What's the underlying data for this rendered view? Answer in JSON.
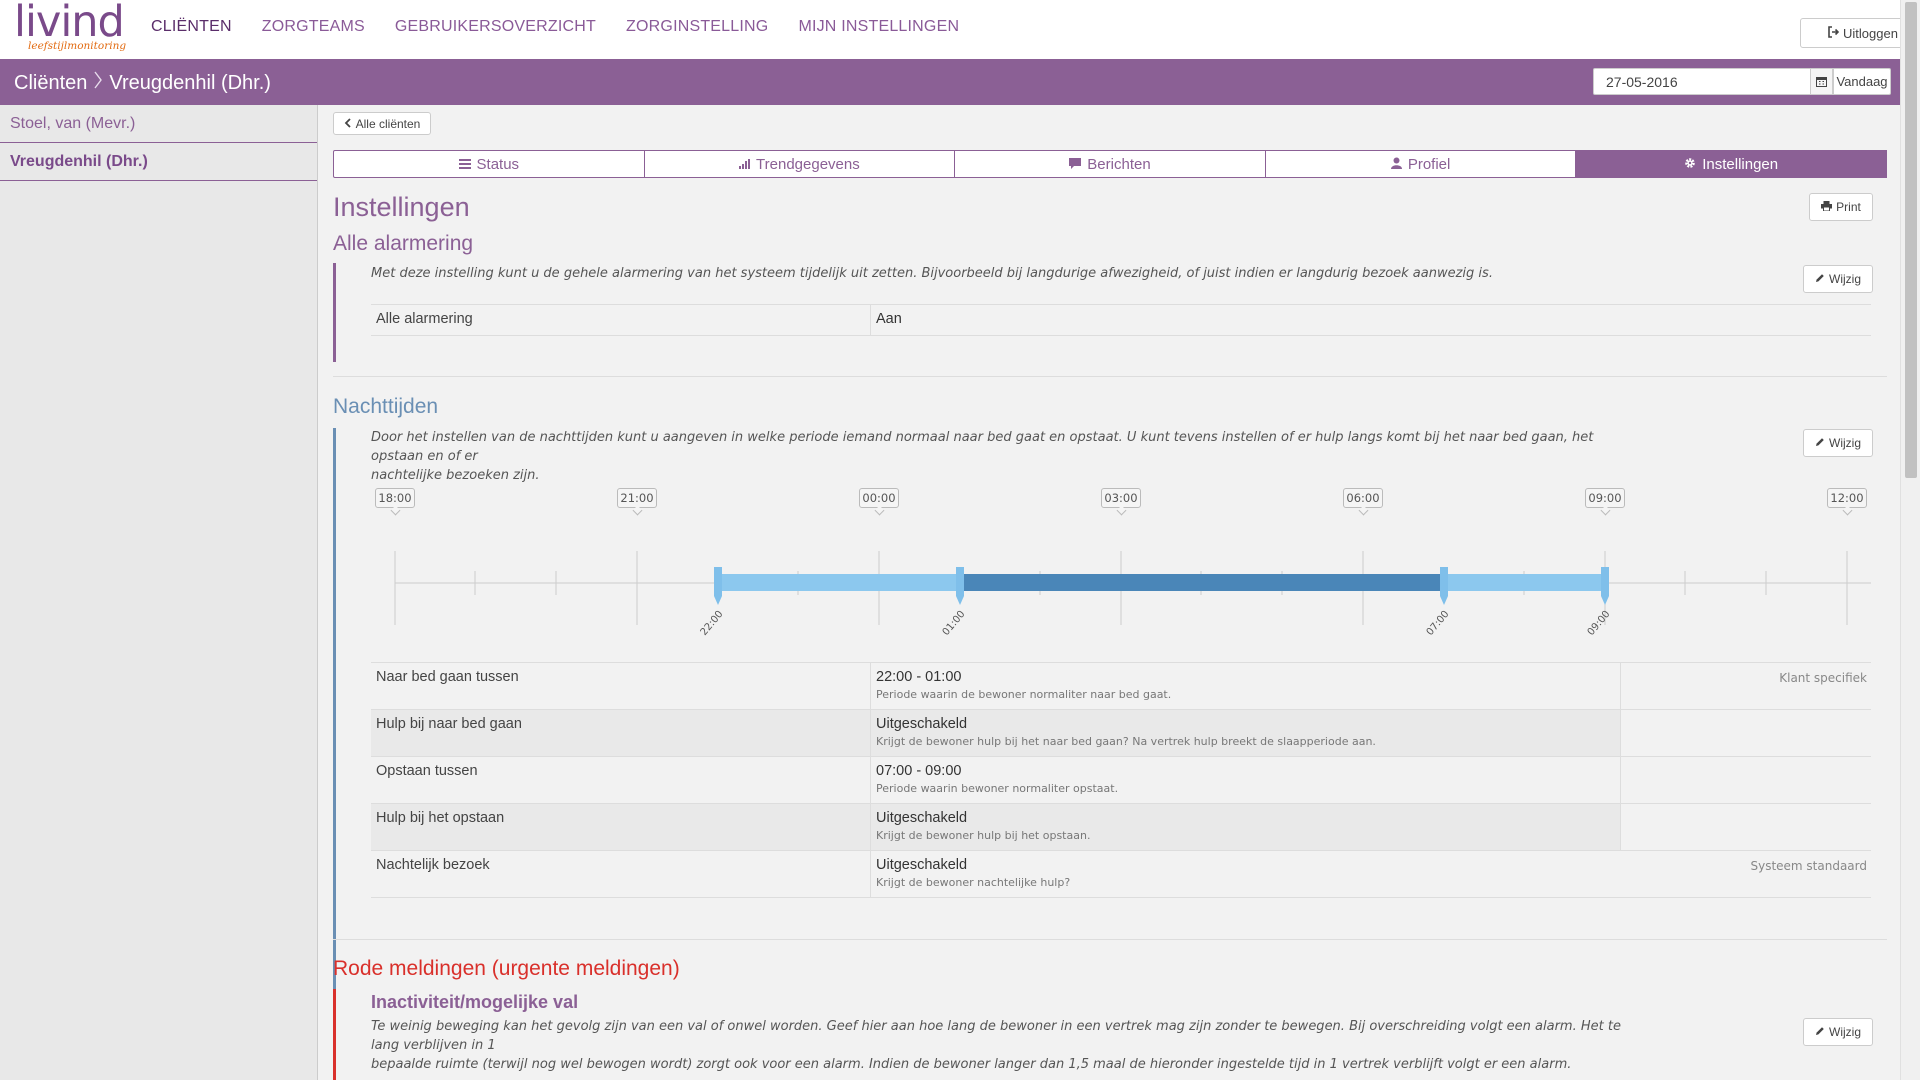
{
  "brand": {
    "name": "livind",
    "tagline": "leefstijlmonitoring"
  },
  "nav": [
    {
      "label": "CLIËNTEN",
      "active": true
    },
    {
      "label": "ZORGTEAMS"
    },
    {
      "label": "GEBRUIKERSOVERZICHT"
    },
    {
      "label": "ZORGINSTELLING"
    },
    {
      "label": "MIJN INSTELLINGEN"
    }
  ],
  "logout_label": "Uitloggen",
  "breadcrumb": {
    "root": "Cliënten",
    "current": "Vreugdenhil (Dhr.)"
  },
  "date": {
    "value": "27-05-2016",
    "today_label": "Vandaag"
  },
  "sidebar": {
    "items": [
      {
        "label": "Stoel, van (Mevr.)"
      },
      {
        "label": "Vreugdenhil (Dhr.)",
        "active": true
      }
    ]
  },
  "back_label": "Alle cliënten",
  "tabs": [
    {
      "label": "Status",
      "icon": "list-icon"
    },
    {
      "label": "Trendgegevens",
      "icon": "bar-chart-icon"
    },
    {
      "label": "Berichten",
      "icon": "message-icon"
    },
    {
      "label": "Profiel",
      "icon": "user-icon"
    },
    {
      "label": "Instellingen",
      "icon": "gear-icon",
      "active": true
    }
  ],
  "page_title": "Instellingen",
  "print_label": "Print",
  "edit_label": "Wijzig",
  "alarm": {
    "title": "Alle alarmering",
    "description": "Met deze instelling kunt u de gehele alarmering van het systeem tijdelijk uit zetten. Bijvoorbeeld bij langdurige afwezigheid, of juist indien er langdurig bezoek aanwezig is.",
    "rows": [
      {
        "key": "Alle alarmering",
        "value": "Aan"
      }
    ]
  },
  "night": {
    "title": "Nachttijden",
    "description_line1": "Door het instellen van de nachttijden kunt u aangeven in welke periode iemand normaal naar bed gaat en opstaat. U kunt tevens instellen of er hulp langs komt bij het naar bed gaan, het opstaan en of er",
    "description_line2": "nachtelijke bezoeken zijn.",
    "timeline_labels": [
      "18:00",
      "21:00",
      "00:00",
      "03:00",
      "06:00",
      "09:00",
      "12:00"
    ],
    "handle_labels": [
      "22:00",
      "01:00",
      "07:00",
      "09:00"
    ],
    "rows": [
      {
        "key": "Naar bed gaan tussen",
        "value": "22:00 - 01:00",
        "sub": "Periode waarin de bewoner normaliter naar bed gaat.",
        "note": "Klant specifiek"
      },
      {
        "key": "Hulp bij naar bed gaan",
        "value": "Uitgeschakeld",
        "sub": "Krijgt de bewoner hulp bij het naar bed gaan? Na vertrek hulp breekt de slaapperiode aan.",
        "note": ""
      },
      {
        "key": "Opstaan tussen",
        "value": "07:00 - 09:00",
        "sub": "Periode waarin bewoner normaliter opstaat.",
        "note": ""
      },
      {
        "key": "Hulp bij het opstaan",
        "value": "Uitgeschakeld",
        "sub": "Krijgt de bewoner hulp bij het opstaan.",
        "note": ""
      },
      {
        "key": "Nachtelijk bezoek",
        "value": "Uitgeschakeld",
        "sub": "Krijgt de bewoner nachtelijke hulp?",
        "note": "Systeem standaard"
      }
    ]
  },
  "red": {
    "title": "Rode meldingen (urgente meldingen)",
    "sub_title": "Inactiviteit/mogelijke val",
    "description_line1": "Te weinig beweging kan het gevolg zijn van een val of onwel worden. Geef hier aan hoe lang de bewoner in een vertrek mag zijn zonder te bewegen. Bij overschreiding volgt een alarm. Het te lang verblijven in 1",
    "description_line2": "bepaalde ruimte (terwijl nog wel bewogen wordt) zorgt ook voor een alarm. Indien de bewoner langer dan 1,5 maal de hieronder ingestelde tijd in 1 vertrek verblijft volgt er een alarm."
  },
  "colors": {
    "accent": "#8b6095",
    "blue_section": "#6a8fb4",
    "red_section": "#d9302b",
    "range_light": "#8cc8ee",
    "range_dark": "#4a86b8"
  }
}
